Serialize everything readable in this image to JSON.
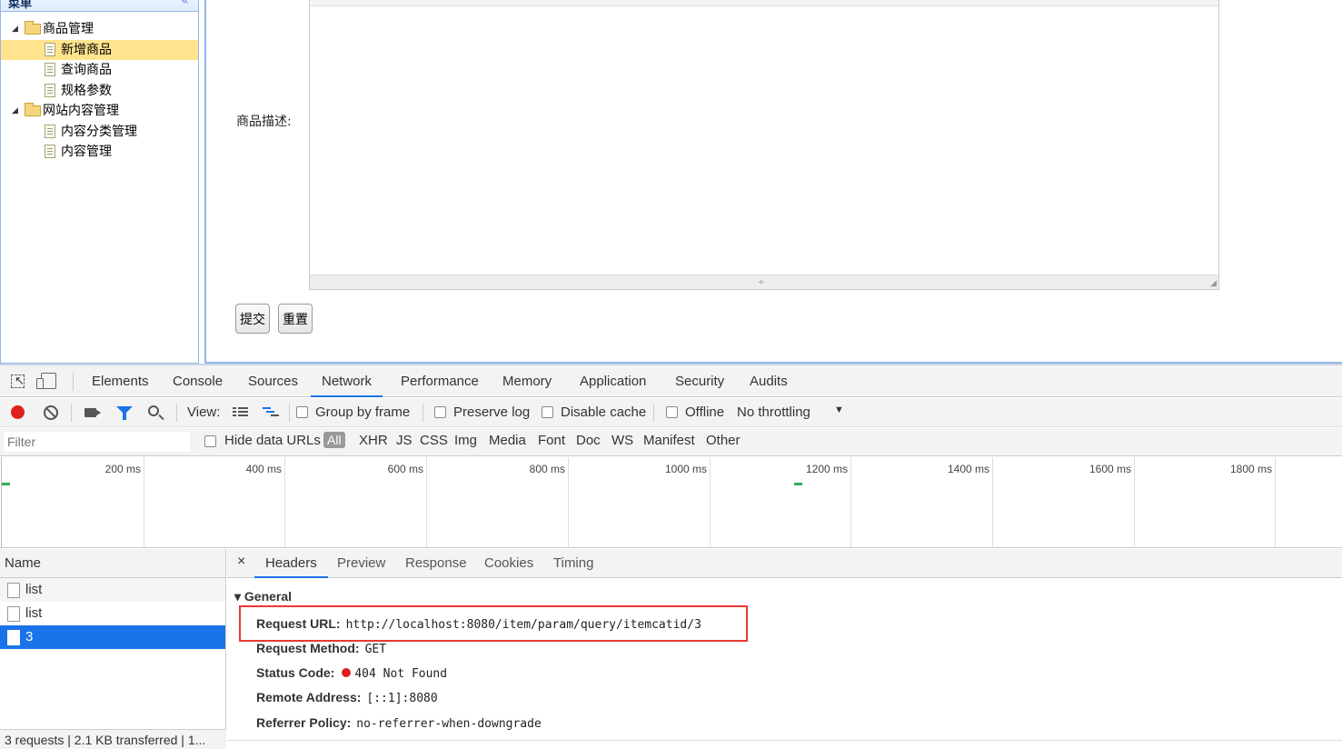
{
  "app": {
    "menu": {
      "title": "菜单",
      "collapse_glyph": "«",
      "items": [
        {
          "label": "商品管理",
          "type": "folder"
        },
        {
          "label": "新增商品",
          "type": "file",
          "selected": true
        },
        {
          "label": "查询商品",
          "type": "file"
        },
        {
          "label": "规格参数",
          "type": "file"
        },
        {
          "label": "网站内容管理",
          "type": "folder"
        },
        {
          "label": "内容分类管理",
          "type": "file"
        },
        {
          "label": "内容管理",
          "type": "file"
        }
      ]
    },
    "form": {
      "desc_label": "商品描述:",
      "submit_label": "提交",
      "reset_label": "重置"
    }
  },
  "devtools": {
    "tabs": [
      "Elements",
      "Console",
      "Sources",
      "Network",
      "Performance",
      "Memory",
      "Application",
      "Security",
      "Audits"
    ],
    "active_tab": "Network",
    "toolbar": {
      "view_label": "View:",
      "group_by_frame": "Group by frame",
      "preserve_log": "Preserve log",
      "disable_cache": "Disable cache",
      "offline": "Offline",
      "throttling": "No throttling"
    },
    "filter": {
      "placeholder": "Filter",
      "hide_data_urls": "Hide data URLs",
      "types": [
        "All",
        "XHR",
        "JS",
        "CSS",
        "Img",
        "Media",
        "Font",
        "Doc",
        "WS",
        "Manifest",
        "Other"
      ]
    },
    "overview": {
      "labels": [
        "200 ms",
        "400 ms",
        "600 ms",
        "800 ms",
        "1000 ms",
        "1200 ms",
        "1400 ms",
        "1600 ms",
        "1800 ms"
      ],
      "request_marks_ms": [
        0,
        1120
      ]
    },
    "requests": {
      "header": "Name",
      "rows": [
        "list",
        "list",
        "3"
      ],
      "selected_index": 2,
      "summary": "3 requests  |  2.1 KB transferred  |  1..."
    },
    "detail": {
      "tabs": [
        "Headers",
        "Preview",
        "Response",
        "Cookies",
        "Timing"
      ],
      "active_tab": "Headers",
      "close_glyph": "×",
      "general_title": "General",
      "general": [
        {
          "key": "Request URL:",
          "value": "http://localhost:8080/item/param/query/itemcatid/3"
        },
        {
          "key": "Request Method:",
          "value": "GET"
        },
        {
          "key": "Status Code:",
          "value": "404 Not Found"
        },
        {
          "key": "Remote Address:",
          "value": "[::1]:8080"
        },
        {
          "key": "Referrer Policy:",
          "value": "no-referrer-when-downgrade"
        }
      ]
    }
  },
  "colors": {
    "accent": "#1a73e8",
    "record": "#e02020",
    "highlight": "#e53935",
    "menu_selected": "#ffe48d"
  }
}
